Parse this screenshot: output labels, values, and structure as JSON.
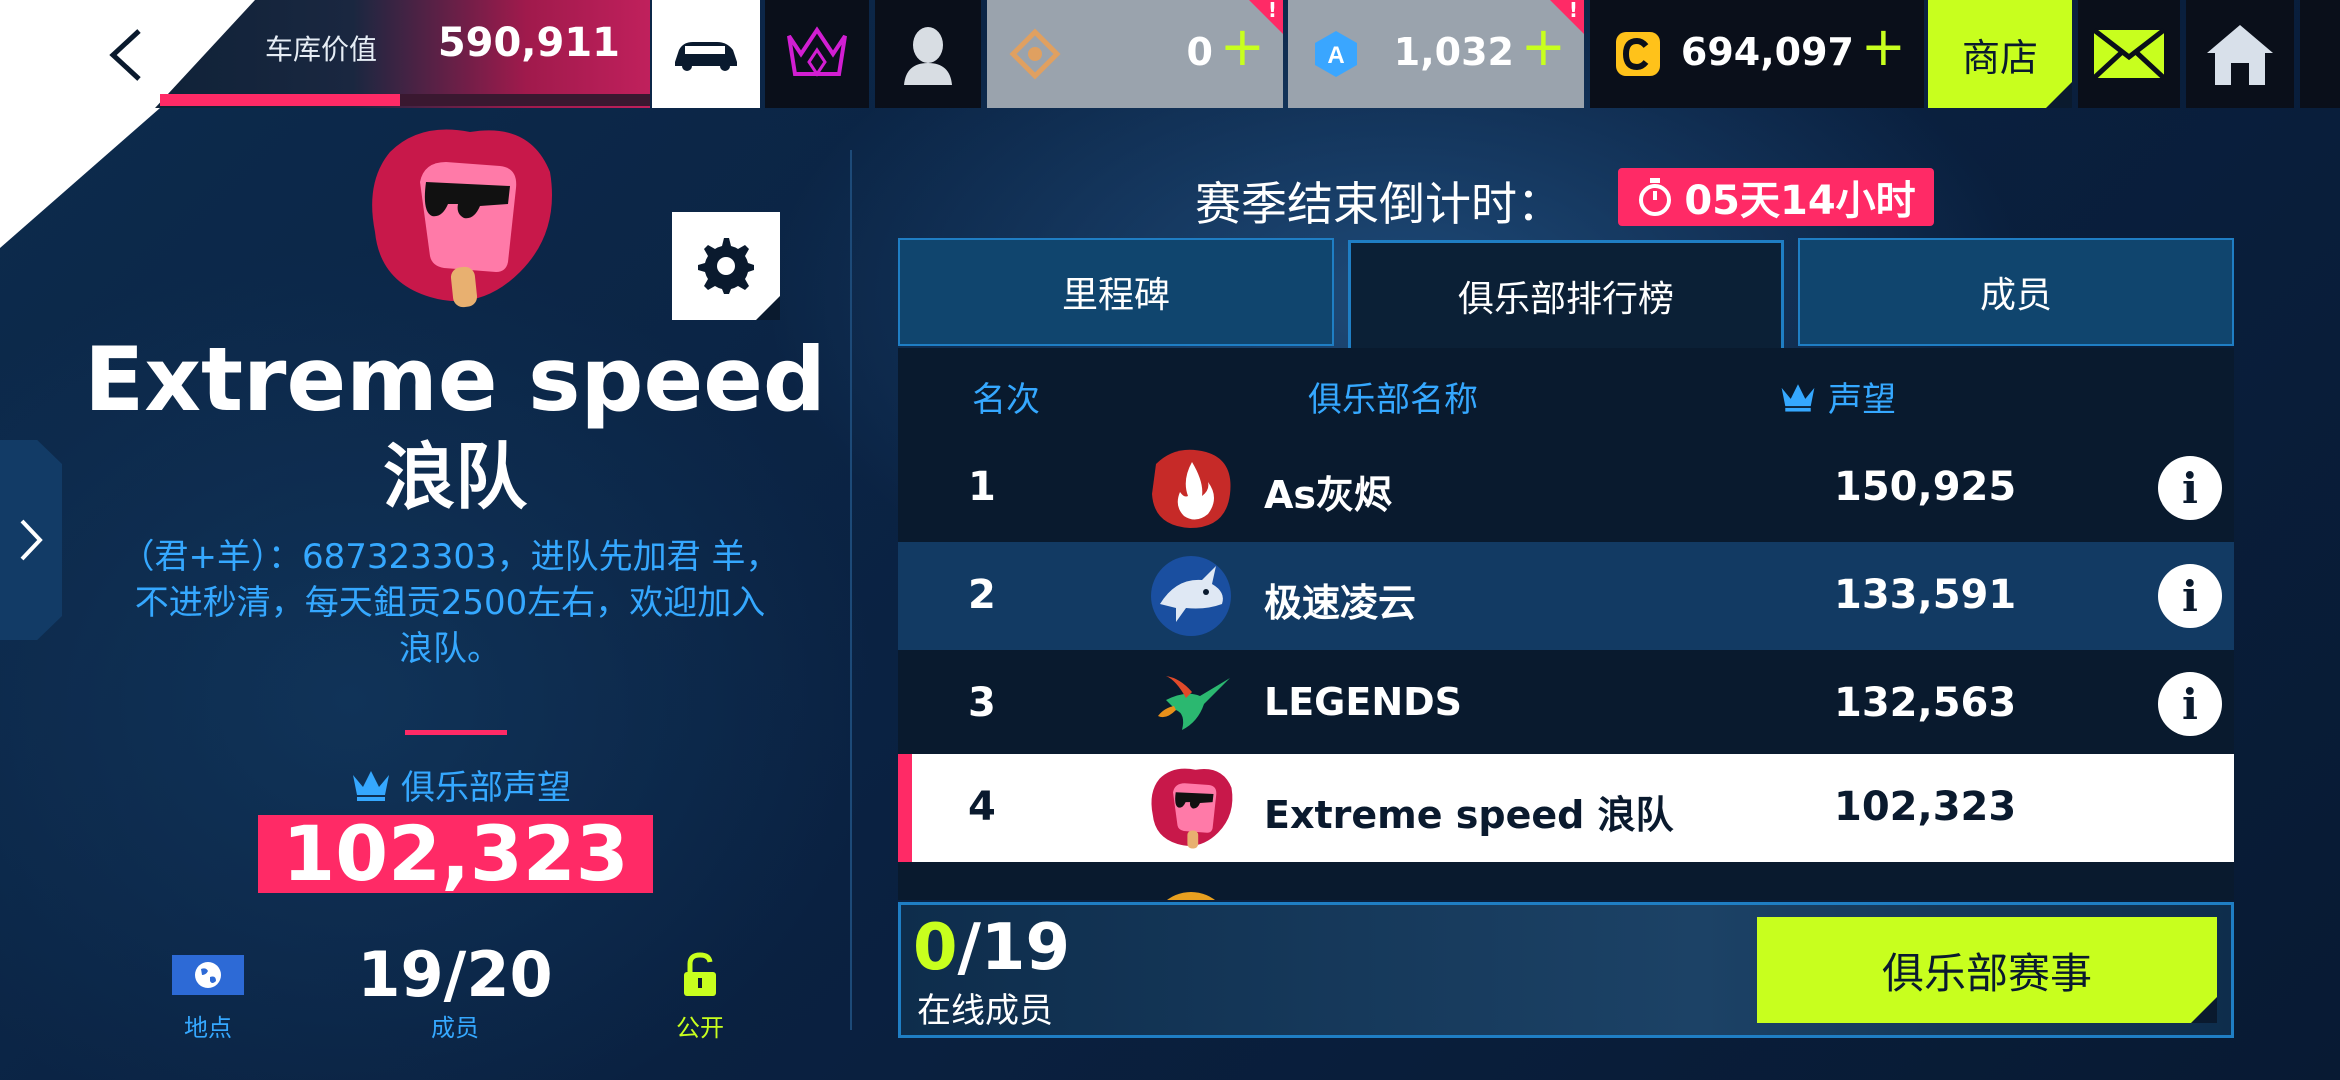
{
  "topbar": {
    "garage_label": "车库价值",
    "garage_value": "590,911",
    "currencies": [
      {
        "value": "0",
        "plus": "+",
        "alert": "!"
      },
      {
        "value": "1,032",
        "plus": "+",
        "alert": "!"
      },
      {
        "value": "694,097",
        "plus": "+"
      }
    ],
    "shop_label": "商店"
  },
  "club": {
    "name": "Extreme speed",
    "name2": "浪队",
    "description": "（君+羊）：687323303，进队先加君 羊，不进秒清，每天鉏贡2500左右，欢迎加入浪队。",
    "reputation_label": "俱乐部声望",
    "reputation_value": "102,323",
    "location_label": "地点",
    "members_value": "19/20",
    "members_label": "成员",
    "privacy_label": "公开"
  },
  "season": {
    "countdown_label": "赛季结束倒计时：",
    "countdown_value": "05天14小时"
  },
  "tabs": [
    {
      "label": "里程碑"
    },
    {
      "label": "俱乐部排行榜"
    },
    {
      "label": "成员"
    }
  ],
  "leaderboard": {
    "headers": {
      "rank": "名次",
      "name": "俱乐部名称",
      "reputation": "声望"
    },
    "rows": [
      {
        "rank": "1",
        "name": "As灰烬",
        "reputation": "150,925",
        "info": "i"
      },
      {
        "rank": "2",
        "name": "极速凌云",
        "reputation": "133,591",
        "info": "i"
      },
      {
        "rank": "3",
        "name": "LEGENDS",
        "reputation": "132,563",
        "info": "i"
      },
      {
        "rank": "4",
        "name": "Extreme speed 浪队",
        "reputation": "102,323"
      }
    ]
  },
  "bottom": {
    "online_count": "0",
    "online_total": "/19",
    "online_label": "在线成员",
    "event_button": "俱乐部赛事"
  },
  "colors": {
    "accent_pink": "#ff2a66",
    "accent_lime": "#c8ff1e",
    "accent_blue": "#35a8ff"
  }
}
